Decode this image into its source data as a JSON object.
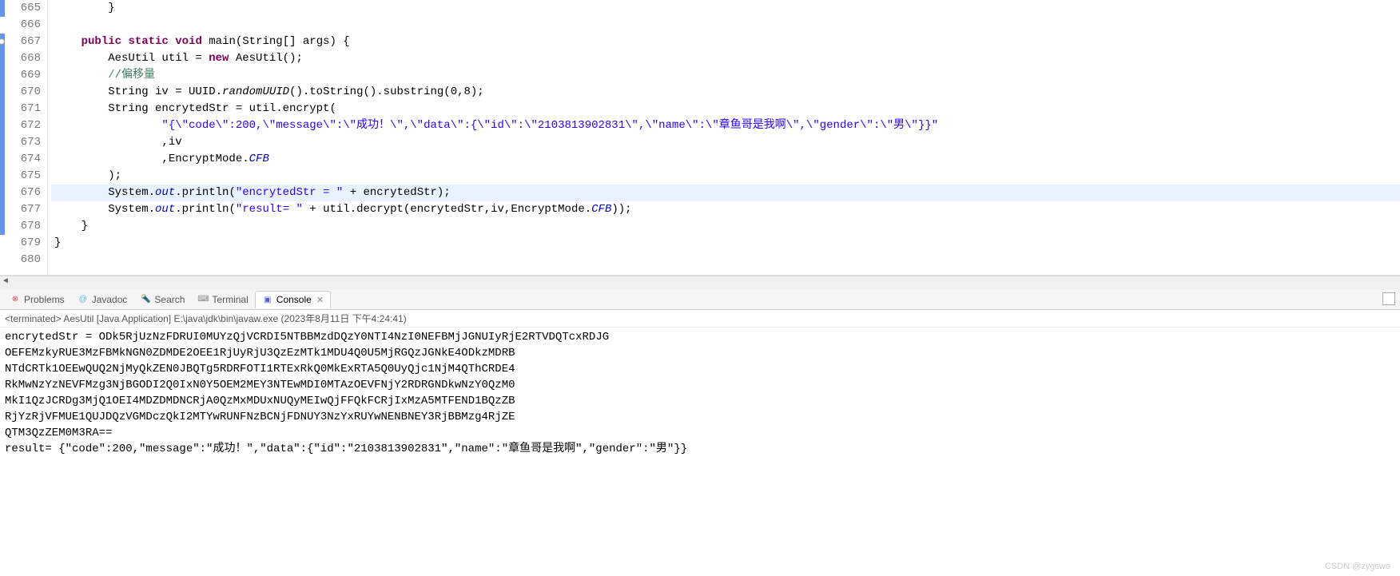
{
  "editor": {
    "lines": [
      {
        "num": "665",
        "marker": true,
        "html": "        }"
      },
      {
        "num": "666",
        "marker": false,
        "html": ""
      },
      {
        "num": "667",
        "marker": true,
        "circle": true,
        "html": "    <span class='kw'>public</span> <span class='kw'>static</span> <span class='kw'>void</span> main(String[] args) {"
      },
      {
        "num": "668",
        "marker": true,
        "html": "        AesUtil util = <span class='kw'>new</span> AesUtil();"
      },
      {
        "num": "669",
        "marker": true,
        "html": "        <span class='com'>//偏移量</span>"
      },
      {
        "num": "670",
        "marker": true,
        "html": "        String iv = UUID.<span class='si'>randomUUID</span>().toString().substring(0,8);"
      },
      {
        "num": "671",
        "marker": true,
        "html": "        String encrytedStr = util.encrypt("
      },
      {
        "num": "672",
        "marker": true,
        "html": "                <span class='str'>\"{\\\"code\\\":200,\\\"message\\\":\\\"成功！\\\",\\\"data\\\":{\\\"id\\\":\\\"2103813902831\\\",\\\"name\\\":\\\"章鱼哥是我啊\\\",\\\"gender\\\":\\\"男\\\"}}\"</span>"
      },
      {
        "num": "673",
        "marker": true,
        "html": "                ,iv"
      },
      {
        "num": "674",
        "marker": true,
        "html": "                ,EncryptMode.<span class='sf'>CFB</span>"
      },
      {
        "num": "675",
        "marker": true,
        "html": "        );"
      },
      {
        "num": "676",
        "marker": true,
        "highlight": true,
        "html": "        System.<span class='sf'>out</span>.println(<span class='str'>\"encrytedStr = \"</span> + encrytedStr);"
      },
      {
        "num": "677",
        "marker": true,
        "html": "        System.<span class='sf'>out</span>.println(<span class='str'>\"result= \"</span> + util.decrypt(encrytedStr,iv,EncryptMode.<span class='sf'>CFB</span>));"
      },
      {
        "num": "678",
        "marker": true,
        "html": "    }"
      },
      {
        "num": "679",
        "marker": false,
        "html": "}"
      },
      {
        "num": "680",
        "marker": false,
        "html": ""
      }
    ]
  },
  "tabs": {
    "problems": "Problems",
    "javadoc": "Javadoc",
    "search": "Search",
    "terminal": "Terminal",
    "console": "Console"
  },
  "console": {
    "header": "<terminated> AesUtil [Java Application] E:\\java\\jdk\\bin\\javaw.exe (2023年8月11日 下午4:24:41)",
    "output": "encrytedStr = ODk5RjUzNzFDRUI0MUYzQjVCRDI5NTBBMzdDQzY0NTI4NzI0NEFBMjJGNUIyRjE2RTVDQTcxRDJG\nOEFEMzkyRUE3MzFBMkNGN0ZDMDE2OEE1RjUyRjU3QzEzMTk1MDU4Q0U5MjRGQzJGNkE4ODkzMDRB\nNTdCRTk1OEEwQUQ2NjMyQkZEN0JBQTg5RDRFOTI1RTExRkQ0MkExRTA5Q0UyQjc1NjM4QThCRDE4\nRkMwNzYzNEVFMzg3NjBGODI2Q0IxN0Y5OEM2MEY3NTEwMDI0MTAzOEVFNjY2RDRGNDkwNzY0QzM0\nMkI1QzJCRDg3MjQ1OEI4MDZDMDNCRjA0QzMxMDUxNUQyMEIwQjFFQkFCRjIxMzA5MTFEND1BQzZB\nRjYzRjVFMUE1QUJDQzVGMDczQkI2MTYwRUNFNzBCNjFDNUY3NzYxRUYwNENBNEY3RjBBMzg4RjZE\nQTM3QzZEM0M3RA==\nresult= {\"code\":200,\"message\":\"成功！\",\"data\":{\"id\":\"2103813902831\",\"name\":\"章鱼哥是我啊\",\"gender\":\"男\"}}"
  },
  "watermark": "CSDN @zygswo"
}
